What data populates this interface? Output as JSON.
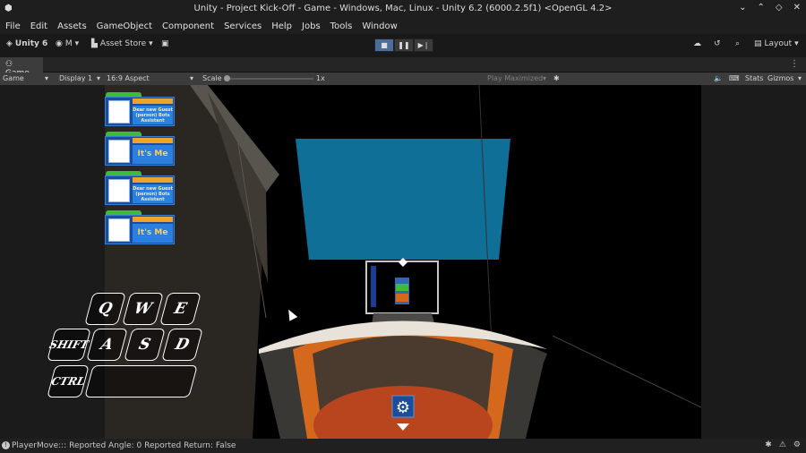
{
  "window": {
    "title": "Unity - Project Kick-Off - Game - Windows, Mac, Linux - Unity 6.2 (6000.2.5f1) <OpenGL 4.2>",
    "controls": [
      "⌄",
      "⌃",
      "◇",
      "✕"
    ]
  },
  "menu": [
    "File",
    "Edit",
    "Assets",
    "GameObject",
    "Component",
    "Services",
    "Help",
    "Jobs",
    "Tools",
    "Window"
  ],
  "toolbar": {
    "unity_label": "Unity 6",
    "account_label": "M",
    "asset_store_label": "Asset Store",
    "layout_label": "Layout"
  },
  "tabs": {
    "game_tab": "Game"
  },
  "gamebar": {
    "display_mode": "Game",
    "display": "Display 1",
    "aspect": "16:9 Aspect",
    "scale_label": "Scale",
    "scale_value": "1x",
    "scale_fraction": 0.0,
    "play_mode": "Play Maximized",
    "stats": "Stats",
    "gizmos": "Gizmos"
  },
  "cards": [
    {
      "text": "Dear new Guest (person) Bots Assistant",
      "big": false
    },
    {
      "text": "It's Me",
      "big": true
    },
    {
      "text": "Dear new Guest (person) Bots Assistant",
      "big": false
    },
    {
      "text": "It's Me",
      "big": true
    }
  ],
  "keys": {
    "q": "Q",
    "w": "W",
    "e": "E",
    "shift": "SHIFT",
    "a": "A",
    "s": "S",
    "d": "D",
    "ctrl": "CTRL"
  },
  "status": {
    "message": "PlayerMove::: Reported Angle: 0 Reported Return: False"
  },
  "colors": {
    "screen": "#0f6f96",
    "desk_orange": "#d4681c",
    "floor_red": "#b8451d",
    "card_blue": "#1b4d9b",
    "tab_green": "#3dbb3a",
    "play_active": "#4a6d9b"
  }
}
